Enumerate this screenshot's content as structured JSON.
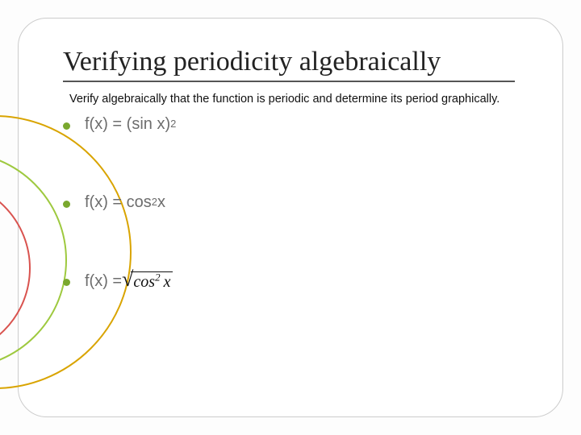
{
  "title": "Verifying periodicity algebraically",
  "instruction": "Verify algebraically that the function is periodic and determine its period graphically.",
  "items": {
    "a_prefix": "f(x) = (sin x)",
    "a_sup": "2",
    "b_prefix": "f(x) = cos",
    "b_sup": "2",
    "b_suffix": "x",
    "c_prefix": "f(x) = ",
    "c_sqrt_base": "cos",
    "c_sqrt_sup": "2",
    "c_sqrt_var": "x"
  }
}
